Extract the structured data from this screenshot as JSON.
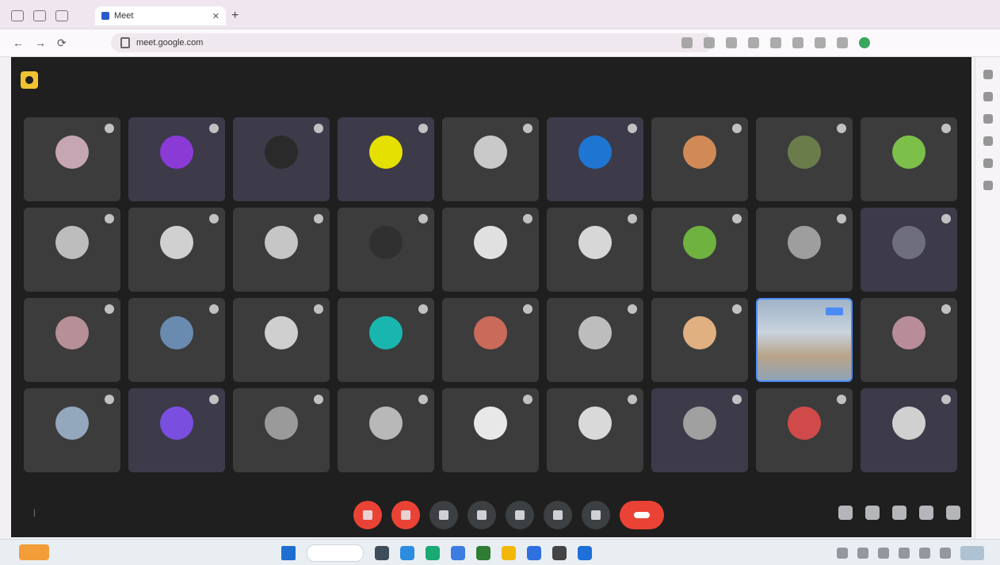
{
  "browser": {
    "tab_title": "Meet",
    "url": "meet.google.com",
    "accent": "#4c8bf5"
  },
  "meeting": {
    "time": "",
    "code": "",
    "participants": [
      {
        "name": "",
        "avatar_color": "#c7a6b3",
        "alt": false
      },
      {
        "name": "",
        "avatar_color": "#8a3bd6",
        "alt": true
      },
      {
        "name": "",
        "avatar_color": "#2a2a2a",
        "alt": true
      },
      {
        "name": "",
        "avatar_color": "#e6e000",
        "alt": true
      },
      {
        "name": "",
        "avatar_color": "#c9c9c9",
        "alt": false
      },
      {
        "name": "",
        "avatar_color": "#1e76d2",
        "alt": true
      },
      {
        "name": "",
        "avatar_color": "#d18a55",
        "alt": false
      },
      {
        "name": "",
        "avatar_color": "#6b7c4b",
        "alt": false
      },
      {
        "name": "",
        "avatar_color": "#7cc04a",
        "alt": false
      },
      {
        "name": "",
        "avatar_color": "#bdbdbd",
        "alt": false
      },
      {
        "name": "",
        "avatar_color": "#d0d0d0",
        "alt": false
      },
      {
        "name": "",
        "avatar_color": "#c6c6c6",
        "alt": false
      },
      {
        "name": "",
        "avatar_color": "#303030",
        "alt": false
      },
      {
        "name": "",
        "avatar_color": "#e0e0e0",
        "alt": false
      },
      {
        "name": "",
        "avatar_color": "#d7d7d7",
        "alt": false
      },
      {
        "name": "",
        "avatar_color": "#6fb23f",
        "alt": false
      },
      {
        "name": "",
        "avatar_color": "#9e9e9e",
        "alt": false
      },
      {
        "name": "",
        "avatar_color": "#6e6e7e",
        "alt": true
      },
      {
        "name": "",
        "avatar_color": "#b78f98",
        "alt": false
      },
      {
        "name": "",
        "avatar_color": "#6a8bb0",
        "alt": false
      },
      {
        "name": "",
        "avatar_color": "#cfcfcf",
        "alt": false
      },
      {
        "name": "",
        "avatar_color": "#19b6b0",
        "alt": false
      },
      {
        "name": "",
        "avatar_color": "#c96a5a",
        "alt": false
      },
      {
        "name": "",
        "avatar_color": "#bdbdbd",
        "alt": false
      },
      {
        "name": "",
        "avatar_color": "#e0b080",
        "alt": false
      },
      {
        "name": "",
        "avatar_color": "video",
        "alt": false
      },
      {
        "name": "",
        "avatar_color": "#b88c98",
        "alt": false
      },
      {
        "name": "",
        "avatar_color": "#93a7bd",
        "alt": false
      },
      {
        "name": "",
        "avatar_color": "#7a4fe0",
        "alt": true
      },
      {
        "name": "",
        "avatar_color": "#9a9a9a",
        "alt": false
      },
      {
        "name": "",
        "avatar_color": "#b8b8b8",
        "alt": false
      },
      {
        "name": "",
        "avatar_color": "#e8e8e8",
        "alt": false
      },
      {
        "name": "",
        "avatar_color": "#d9d9d9",
        "alt": false
      },
      {
        "name": "",
        "avatar_color": "#a0a0a0",
        "alt": true
      },
      {
        "name": "",
        "avatar_color": "#d14a4a",
        "alt": false
      },
      {
        "name": "",
        "avatar_color": "#d0d0d0",
        "alt": true
      }
    ]
  }
}
